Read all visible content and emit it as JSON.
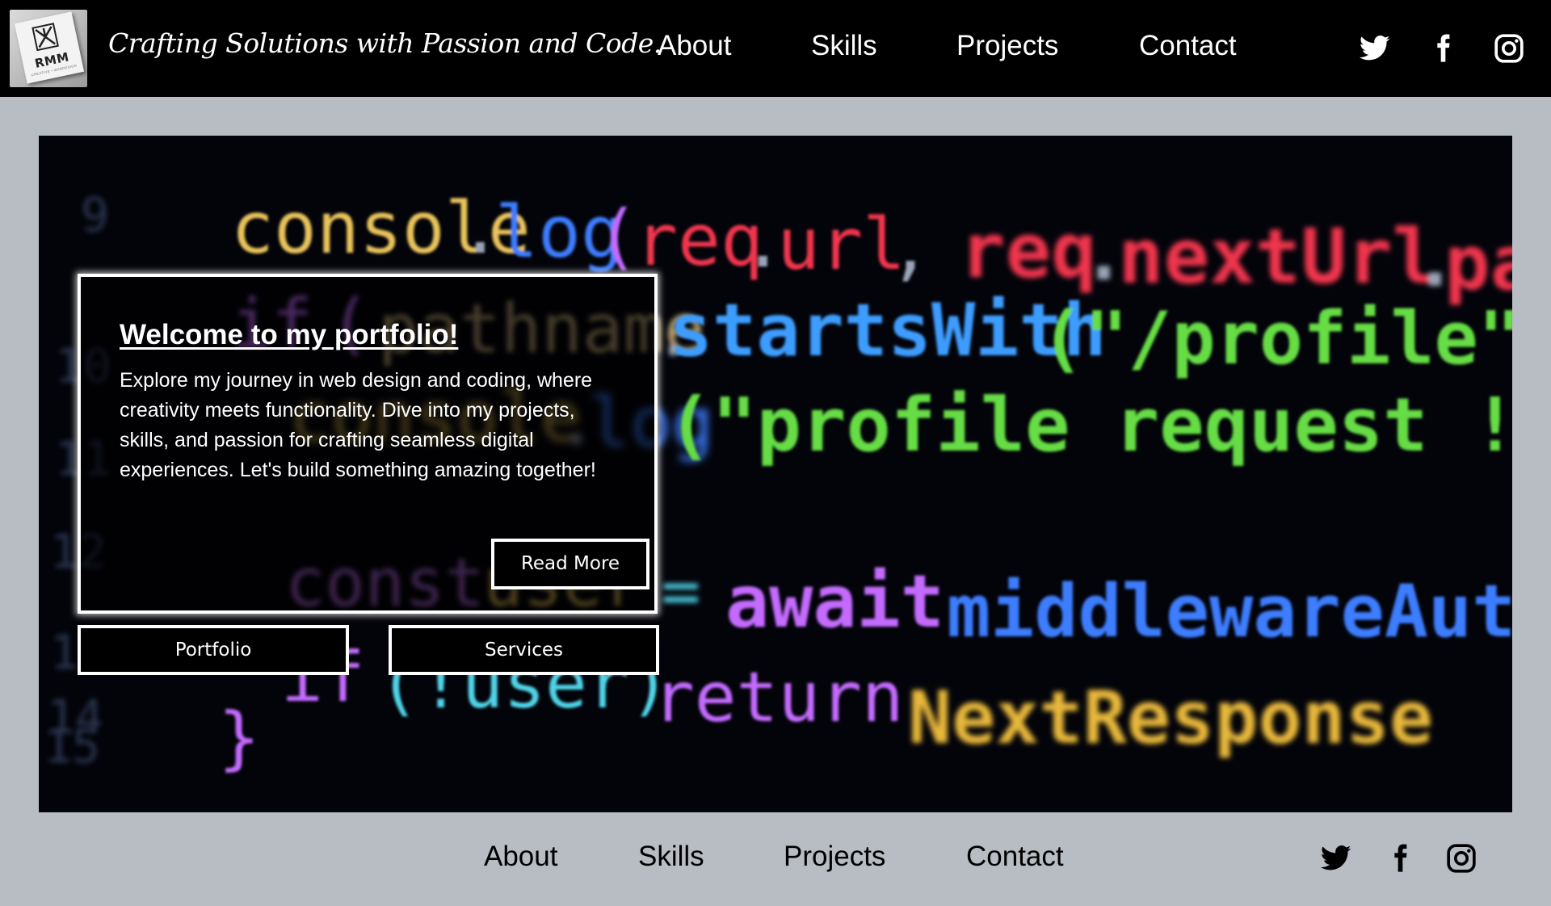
{
  "header": {
    "tagline": "Crafting Solutions with Passion and Code.",
    "logo": {
      "name": "RMM",
      "subtitle": "CREATIVE • WEBDESIGN"
    },
    "nav": [
      {
        "label": "About"
      },
      {
        "label": "Skills"
      },
      {
        "label": "Projects"
      },
      {
        "label": "Contact"
      }
    ],
    "social_icons": [
      "twitter-icon",
      "facebook-icon",
      "instagram-icon"
    ]
  },
  "hero": {
    "title": "Welcome to my portfolio!",
    "text": "Explore my journey in web design and coding, where creativity meets functionality. Dive into my projects, skills, and passion for crafting seamless digital experiences. Let's build something amazing together!",
    "read_more_label": "Read More",
    "portfolio_label": "Portfolio",
    "services_label": "Services",
    "background_code": {
      "line_numbers": [
        "9",
        "10",
        "11",
        "12",
        "13",
        "14",
        "15"
      ],
      "line1": [
        "console",
        ".",
        "log",
        "(",
        "req",
        ".",
        "url",
        ",",
        "req",
        ".",
        "nextUrl",
        ".",
        "pa"
      ],
      "line2": [
        "if",
        "(",
        "pathname",
        ".",
        "startsWith",
        "(\"/profile\""
      ],
      "line3": [
        "console",
        ".",
        "log",
        "(\"profile request !!!\""
      ],
      "line4": [
        "const",
        "user",
        "=",
        "await",
        "middlewareAuth"
      ],
      "line5": [
        "if",
        "(!user)",
        "return",
        "NextResponse"
      ],
      "line6": [
        "}"
      ]
    }
  },
  "footer": {
    "nav": [
      {
        "label": "About"
      },
      {
        "label": "Skills"
      },
      {
        "label": "Projects"
      },
      {
        "label": "Contact"
      }
    ],
    "social_icons": [
      "twitter-icon",
      "facebook-icon",
      "instagram-icon"
    ]
  },
  "colors": {
    "header_bg": "#000000",
    "page_bg": "#b8bcc3",
    "code_bg": "#03040a",
    "code_yellow": "#e8c35a",
    "code_blue": "#3d7dff",
    "code_red": "#f0344d",
    "code_green": "#66dd44",
    "code_purple": "#c46bff",
    "code_cyan": "#4fd3e8"
  }
}
